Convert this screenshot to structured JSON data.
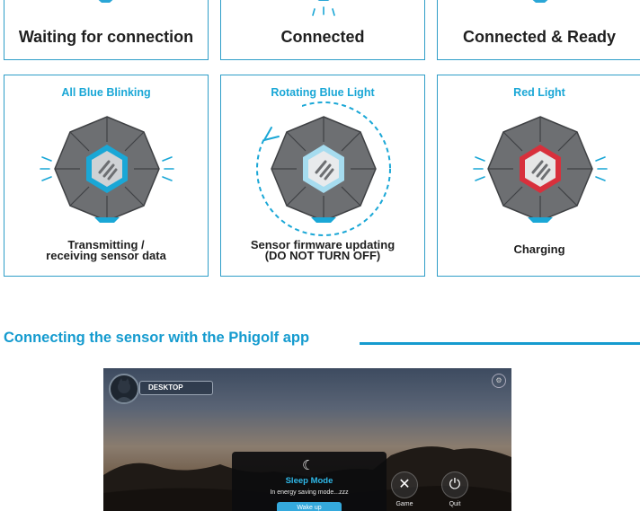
{
  "status_cards_top": [
    {
      "label": "Waiting for connection"
    },
    {
      "label": "Connected"
    },
    {
      "label": "Connected & Ready"
    }
  ],
  "status_cards": [
    {
      "title": "All Blue Blinking",
      "description_line1": "Transmitting /",
      "description_line2": "receiving sensor data",
      "accent": "#1aa7d6"
    },
    {
      "title": "Rotating Blue Light",
      "description_line1": "Sensor firmware updating",
      "description_line2": "(DO NOT TURN OFF)",
      "accent": "#1aa7d6"
    },
    {
      "title": "Red Light",
      "description_line1": "Charging",
      "description_line2": "",
      "accent": "#d8303c"
    }
  ],
  "section": {
    "title": "Connecting the sensor with the Phigolf app"
  },
  "app_screenshot": {
    "profile_name": "DESKTOP",
    "modal_title": "Sleep Mode",
    "modal_text": "In energy saving mode...zzz",
    "modal_button": "Wake up",
    "game_label": "Game",
    "quit_label": "Quit",
    "icons": {
      "moon": "moon-icon",
      "game": "tools-icon",
      "quit": "power-icon"
    }
  },
  "colors": {
    "border": "#2f9ec8",
    "accent": "#1aa7d6",
    "red": "#d8303c"
  }
}
